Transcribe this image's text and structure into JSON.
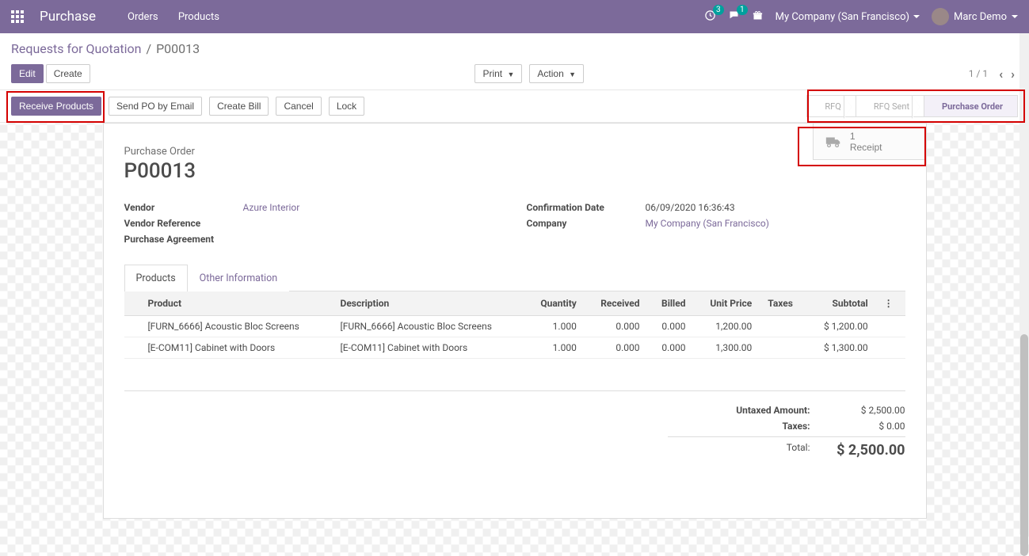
{
  "topnav": {
    "brand": "Purchase",
    "links": [
      "Orders",
      "Products"
    ],
    "activities_count": "3",
    "messages_count": "1",
    "company": "My Company (San Francisco)",
    "user": "Marc Demo"
  },
  "breadcrumb": {
    "parent": "Requests for Quotation",
    "current": "P00013"
  },
  "buttons": {
    "edit": "Edit",
    "create": "Create",
    "print": "Print",
    "action": "Action"
  },
  "pager": {
    "text": "1 / 1"
  },
  "action_buttons": {
    "receive_products": "Receive Products",
    "send_po": "Send PO by Email",
    "create_bill": "Create Bill",
    "cancel": "Cancel",
    "lock": "Lock"
  },
  "statusbar": {
    "steps": [
      "RFQ",
      "RFQ Sent",
      "Purchase Order"
    ],
    "active_index": 2
  },
  "stat_button": {
    "count": "1",
    "label": "Receipt"
  },
  "form": {
    "title_label": "Purchase Order",
    "title": "P00013",
    "vendor_label": "Vendor",
    "vendor_value": "Azure Interior",
    "vendor_ref_label": "Vendor Reference",
    "purchase_agreement_label": "Purchase Agreement",
    "confirmation_date_label": "Confirmation Date",
    "confirmation_date_value": "06/09/2020 16:36:43",
    "company_label": "Company",
    "company_value": "My Company (San Francisco)"
  },
  "tabs": {
    "products": "Products",
    "other_info": "Other Information"
  },
  "table": {
    "headers": {
      "product": "Product",
      "description": "Description",
      "quantity": "Quantity",
      "received": "Received",
      "billed": "Billed",
      "unit_price": "Unit Price",
      "taxes": "Taxes",
      "subtotal": "Subtotal"
    },
    "rows": [
      {
        "product": "[FURN_6666] Acoustic Bloc Screens",
        "description": "[FURN_6666] Acoustic Bloc Screens",
        "quantity": "1.000",
        "received": "0.000",
        "billed": "0.000",
        "unit_price": "1,200.00",
        "taxes": "",
        "subtotal": "$ 1,200.00"
      },
      {
        "product": "[E-COM11] Cabinet with Doors",
        "description": "[E-COM11] Cabinet with Doors",
        "quantity": "1.000",
        "received": "0.000",
        "billed": "0.000",
        "unit_price": "1,300.00",
        "taxes": "",
        "subtotal": "$ 1,300.00"
      }
    ]
  },
  "totals": {
    "untaxed_label": "Untaxed Amount:",
    "untaxed_value": "$ 2,500.00",
    "taxes_label": "Taxes:",
    "taxes_value": "$ 0.00",
    "total_label": "Total:",
    "total_value": "$ 2,500.00"
  }
}
